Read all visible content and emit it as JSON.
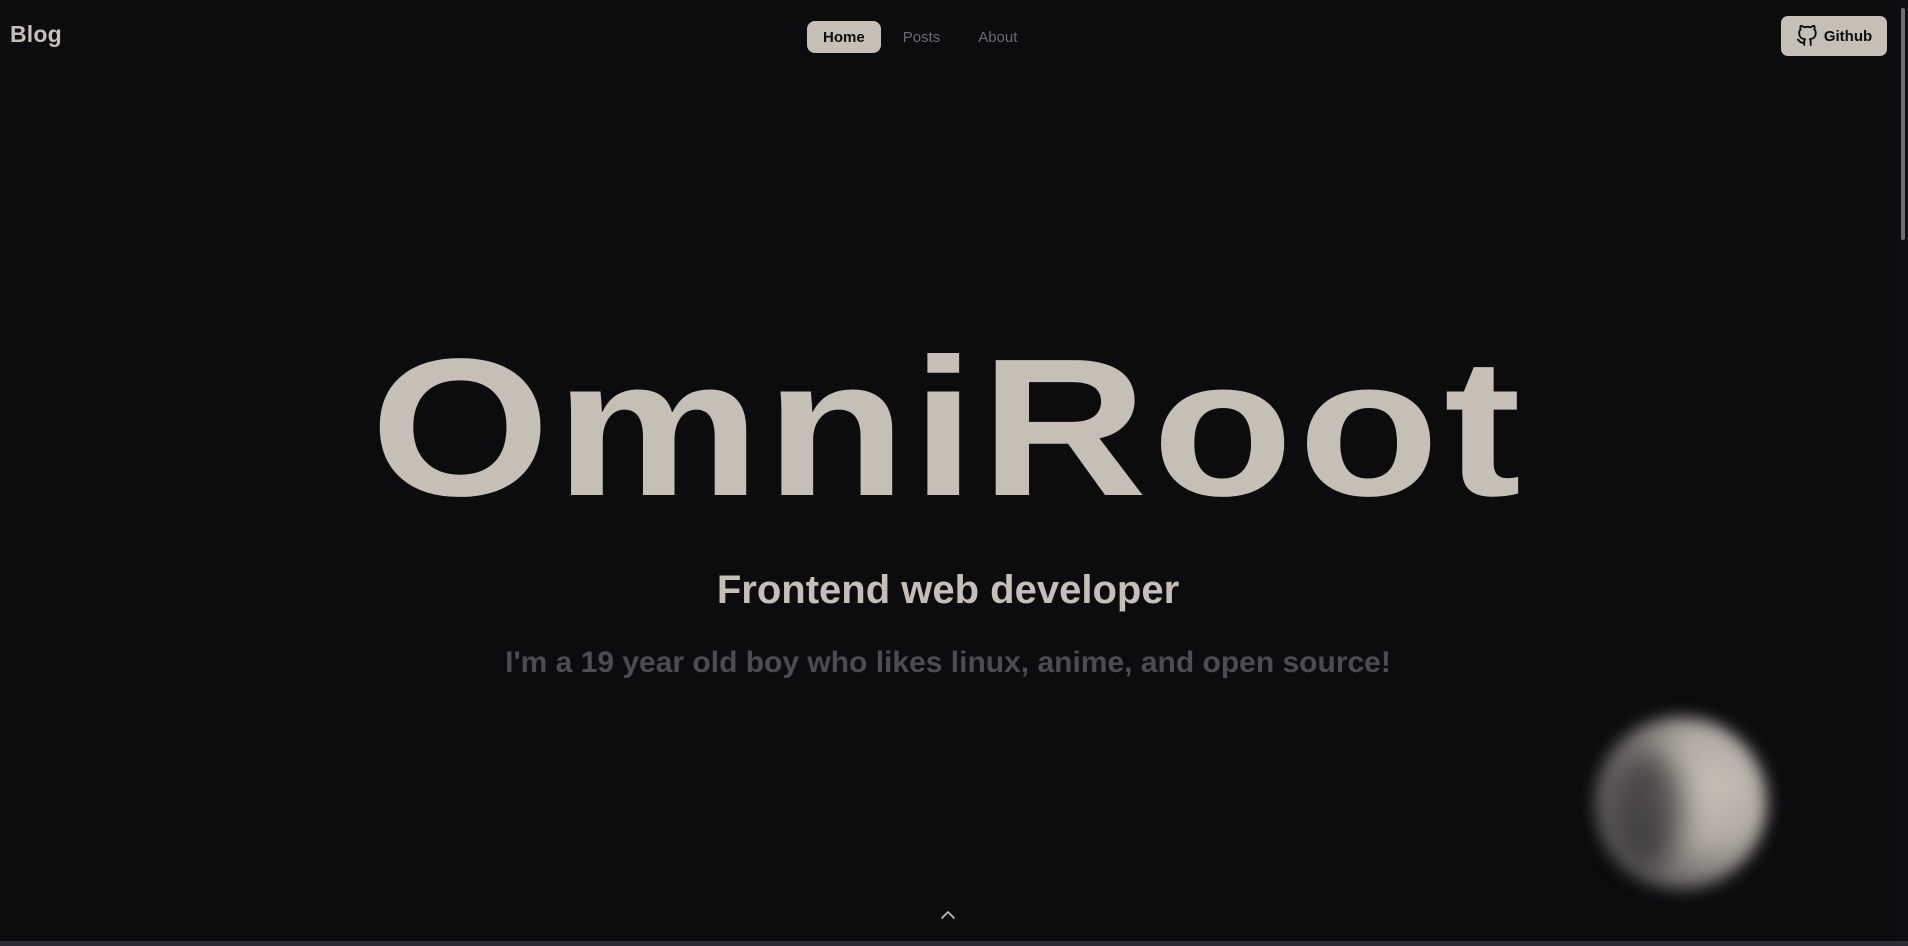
{
  "header": {
    "brand": "Blog",
    "nav": [
      {
        "label": "Home",
        "active": true
      },
      {
        "label": "Posts",
        "active": false
      },
      {
        "label": "About",
        "active": false
      }
    ],
    "github_label": "Github",
    "github_icon": "github-icon"
  },
  "hero": {
    "title": "OmniRoot",
    "subtitle": "Frontend web developer",
    "description": "I'm a 19 year old boy who likes linux, anime, and open source!"
  },
  "decor": {
    "moon_icon": "moon-icon",
    "scroll_up_icon": "chevron-up-icon"
  },
  "colors": {
    "background": "#0c0c0f",
    "accent": "#c5bfb6",
    "muted": "#4e4c50"
  }
}
